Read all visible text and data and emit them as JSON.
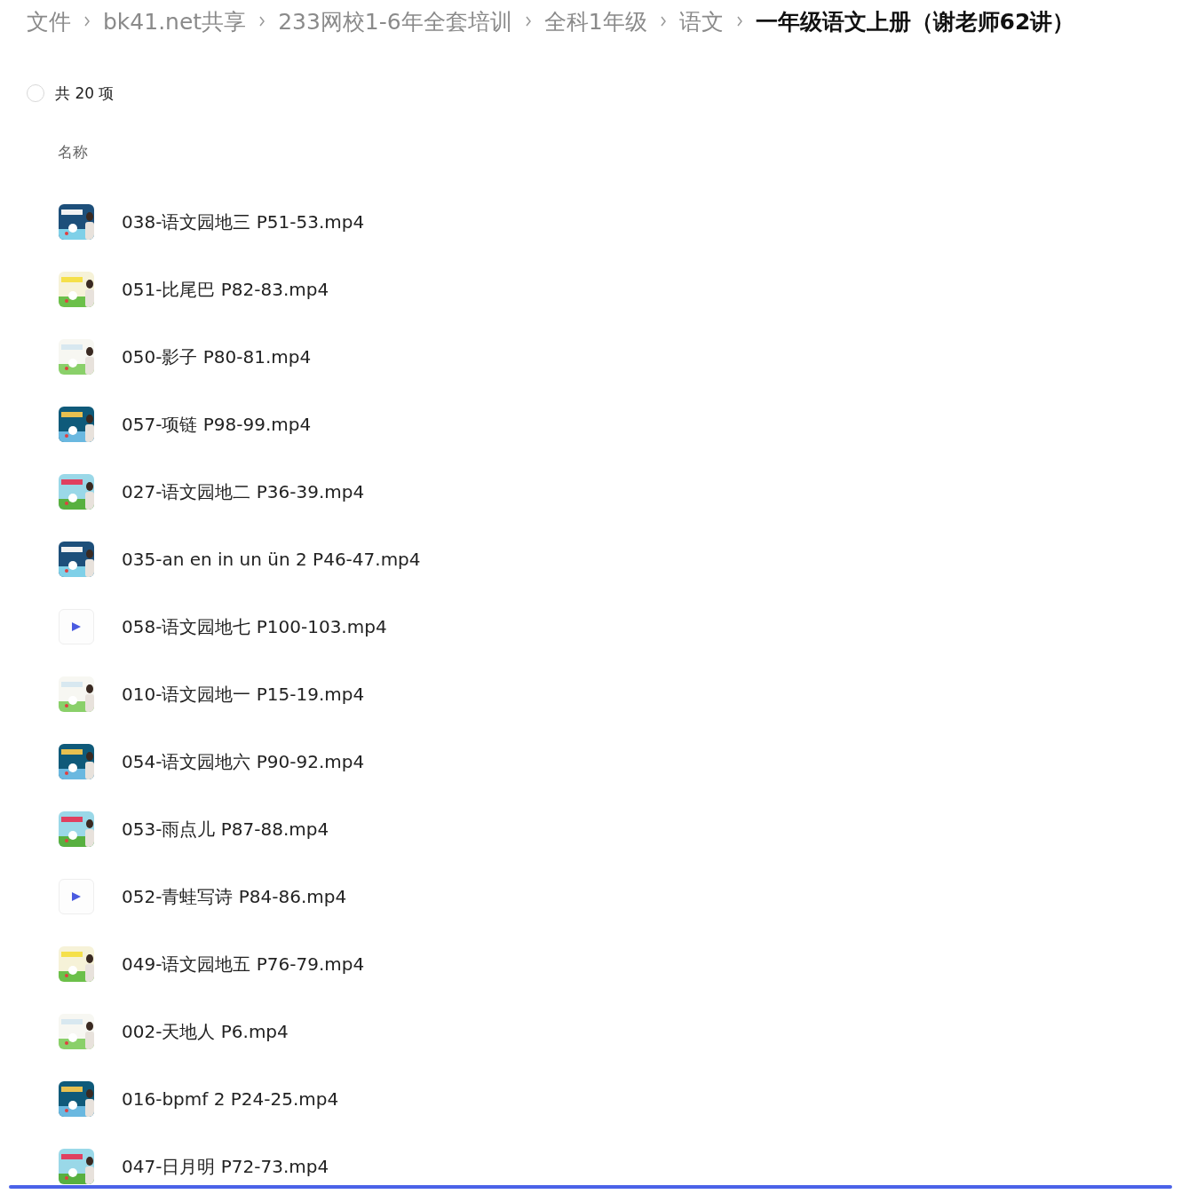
{
  "breadcrumb": [
    {
      "label": "文件",
      "current": false
    },
    {
      "label": "bk41.net共享",
      "current": false
    },
    {
      "label": "233网校1-6年全套培训",
      "current": false
    },
    {
      "label": "全科1年级",
      "current": false
    },
    {
      "label": "语文",
      "current": false
    },
    {
      "label": "一年级语文上册（谢老师62讲）",
      "current": true
    }
  ],
  "select_all": {
    "checked": false,
    "label": "共 20 项"
  },
  "table": {
    "columns": [
      "名称"
    ],
    "rows": [
      {
        "kind": "video",
        "name": "038-语文园地三 P51-53.mp4"
      },
      {
        "kind": "video",
        "name": "051-比尾巴 P82-83.mp4"
      },
      {
        "kind": "video",
        "name": "050-影子 P80-81.mp4"
      },
      {
        "kind": "video",
        "name": "057-项链 P98-99.mp4"
      },
      {
        "kind": "video",
        "name": "027-语文园地二 P36-39.mp4"
      },
      {
        "kind": "video",
        "name": "035-an en in un ün 2 P46-47.mp4"
      },
      {
        "kind": "play",
        "name": "058-语文园地七 P100-103.mp4"
      },
      {
        "kind": "video",
        "name": "010-语文园地一 P15-19.mp4"
      },
      {
        "kind": "video",
        "name": "054-语文园地六 P90-92.mp4"
      },
      {
        "kind": "video",
        "name": "053-雨点儿 P87-88.mp4"
      },
      {
        "kind": "play",
        "name": "052-青蛙写诗 P84-86.mp4"
      },
      {
        "kind": "video",
        "name": "049-语文园地五 P76-79.mp4"
      },
      {
        "kind": "video",
        "name": "002-天地人 P6.mp4"
      },
      {
        "kind": "video",
        "name": "016-bpmf 2 P24-25.mp4"
      },
      {
        "kind": "video",
        "name": "047-日月明 P72-73.mp4"
      }
    ]
  }
}
